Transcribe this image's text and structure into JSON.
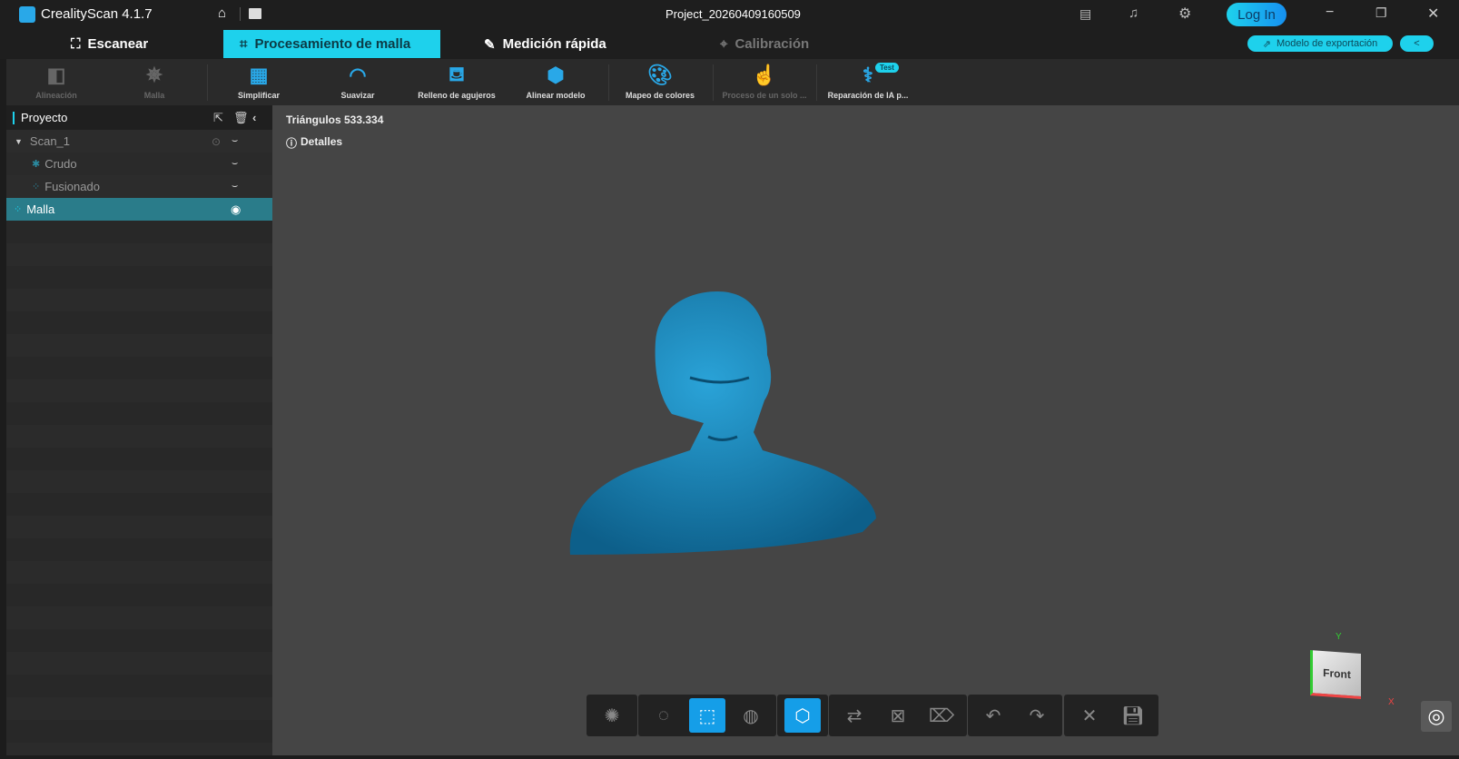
{
  "app": {
    "title": "CrealityScan 4.1.7",
    "project": "Project_20260409160509",
    "login": "Log In"
  },
  "tabs": [
    {
      "label": "Escanear"
    },
    {
      "label": "Procesamiento de malla"
    },
    {
      "label": "Medición rápida"
    },
    {
      "label": "Calibración"
    }
  ],
  "export": {
    "label": "Modelo de exportación"
  },
  "tools": [
    "Alineación",
    "Malla",
    "Simplificar",
    "Suavizar",
    "Relleno de agujeros",
    "Alinear modelo",
    "Mapeo de colores",
    "Proceso de un solo ...",
    "Reparación de IA p..."
  ],
  "tool_badge": "Test",
  "panel": {
    "title": "Proyecto",
    "items": [
      "Scan_1",
      "Crudo",
      "Fusionado",
      "Malla"
    ]
  },
  "viewport": {
    "triangles": "Triángulos 533.334",
    "details": "Detalles",
    "view_cube": "Front",
    "axis_x": "X",
    "axis_y": "Y"
  },
  "colors": {
    "accent": "#1ed1ec",
    "model": "#1a86b8",
    "selected_row": "#2a7c8a"
  }
}
